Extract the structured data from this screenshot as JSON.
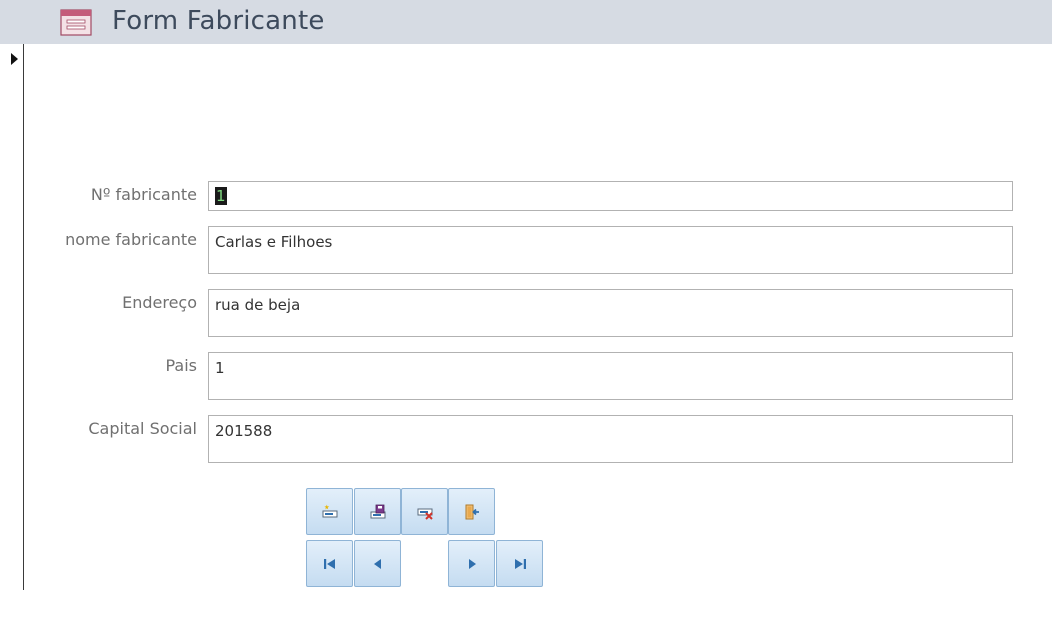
{
  "window": {
    "title": "Form Fabricante",
    "icon": "form-icon"
  },
  "form": {
    "fields": [
      {
        "label": "Nº fabricante",
        "value": "1"
      },
      {
        "label": "nome fabricante",
        "value": "Carlas e Filhoes"
      },
      {
        "label": "Endereço",
        "value": "rua de beja"
      },
      {
        "label": "Pais",
        "value": "1"
      },
      {
        "label": "Capital Social",
        "value": "201588"
      }
    ]
  },
  "buttons": {
    "actions": [
      "new-record-icon",
      "save-record-icon",
      "delete-record-icon",
      "close-form-icon"
    ],
    "navigation": [
      "first-record-icon",
      "previous-record-icon",
      "next-record-icon",
      "last-record-icon"
    ]
  },
  "colors": {
    "titlebar": "#d6dbe3",
    "button_border": "#8fb4d6",
    "button_fill": "#c5dcf1",
    "nav_arrow": "#2f6fae"
  }
}
